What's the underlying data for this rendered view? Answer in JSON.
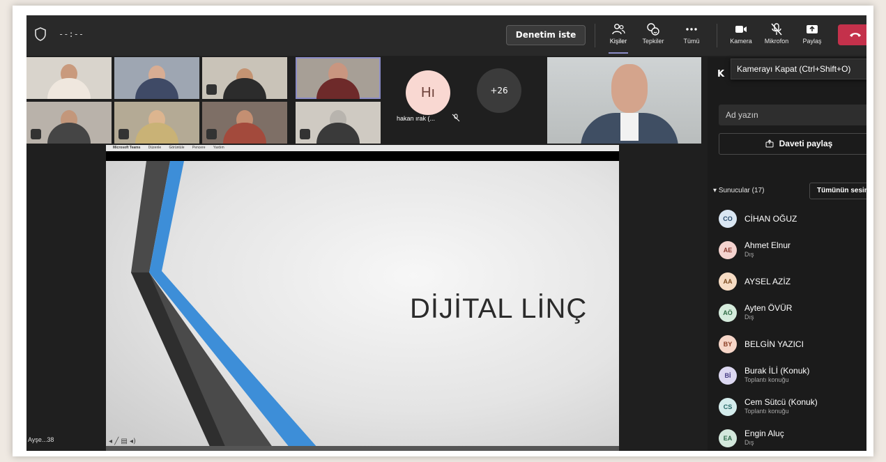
{
  "toolbar": {
    "timer": "--:--",
    "assist_button": "Denetim iste",
    "items": [
      {
        "label": "Kişiler",
        "icon": "people-icon",
        "active": true
      },
      {
        "label": "Tepkiler",
        "icon": "reactions-icon"
      },
      {
        "label": "Tümü",
        "icon": "more-icon"
      },
      {
        "label": "Kamera",
        "icon": "camera-icon"
      },
      {
        "label": "Mikrofon",
        "icon": "mic-off-icon"
      },
      {
        "label": "Paylaş",
        "icon": "share-icon"
      }
    ],
    "leave_color": "#c4314b"
  },
  "tooltip": "Kamerayı Kapat (Ctrl+Shift+O)",
  "gallery": {
    "avatar_initials": "Hı",
    "avatar_name": "hakan ırak (...",
    "overflow_count": "+26"
  },
  "shared_screen": {
    "menubar_items": [
      "Microsoft Teams",
      "Düzenle",
      "Görüntüle",
      "Pencere",
      "Yardım"
    ],
    "slide_title": "DİJİTAL LİNÇ",
    "self_label": "Ayşe...38"
  },
  "panel": {
    "title": "K",
    "name_placeholder": "Ad yazın",
    "share_invite": "Daveti paylaş",
    "section": "Sunucular (17)",
    "mute_all": "Tümünün sesini kapat",
    "participants": [
      {
        "initials": "CO",
        "name": "CİHAN OĞUZ",
        "sub": "",
        "bg": "#d9e6f2",
        "fg": "#2a4d6e"
      },
      {
        "initials": "AE",
        "name": "Ahmet Elnur",
        "sub": "Dış",
        "bg": "#f4d3cf",
        "fg": "#8a3a2f"
      },
      {
        "initials": "AA",
        "name": "AYSEL AZİZ",
        "sub": "",
        "bg": "#f6dcc4",
        "fg": "#7a4a1e"
      },
      {
        "initials": "AÖ",
        "name": "Ayten ÖVÜR",
        "sub": "Dış",
        "bg": "#d5ebdc",
        "fg": "#2e6a43"
      },
      {
        "initials": "BY",
        "name": "BELGİN YAZICI",
        "sub": "",
        "bg": "#f6d6c8",
        "fg": "#8a3c22"
      },
      {
        "initials": "Bİ",
        "name": "Burak İLİ (Konuk)",
        "sub": "Toplantı konuğu",
        "bg": "#dcd8f1",
        "fg": "#463c85"
      },
      {
        "initials": "CS",
        "name": "Cem Sütcü (Konuk)",
        "sub": "Toplantı konuğu",
        "bg": "#d4ecec",
        "fg": "#236666"
      },
      {
        "initials": "EA",
        "name": "Engin Aluç",
        "sub": "Dış",
        "bg": "#d3e8dc",
        "fg": "#2f6a4b"
      }
    ]
  }
}
